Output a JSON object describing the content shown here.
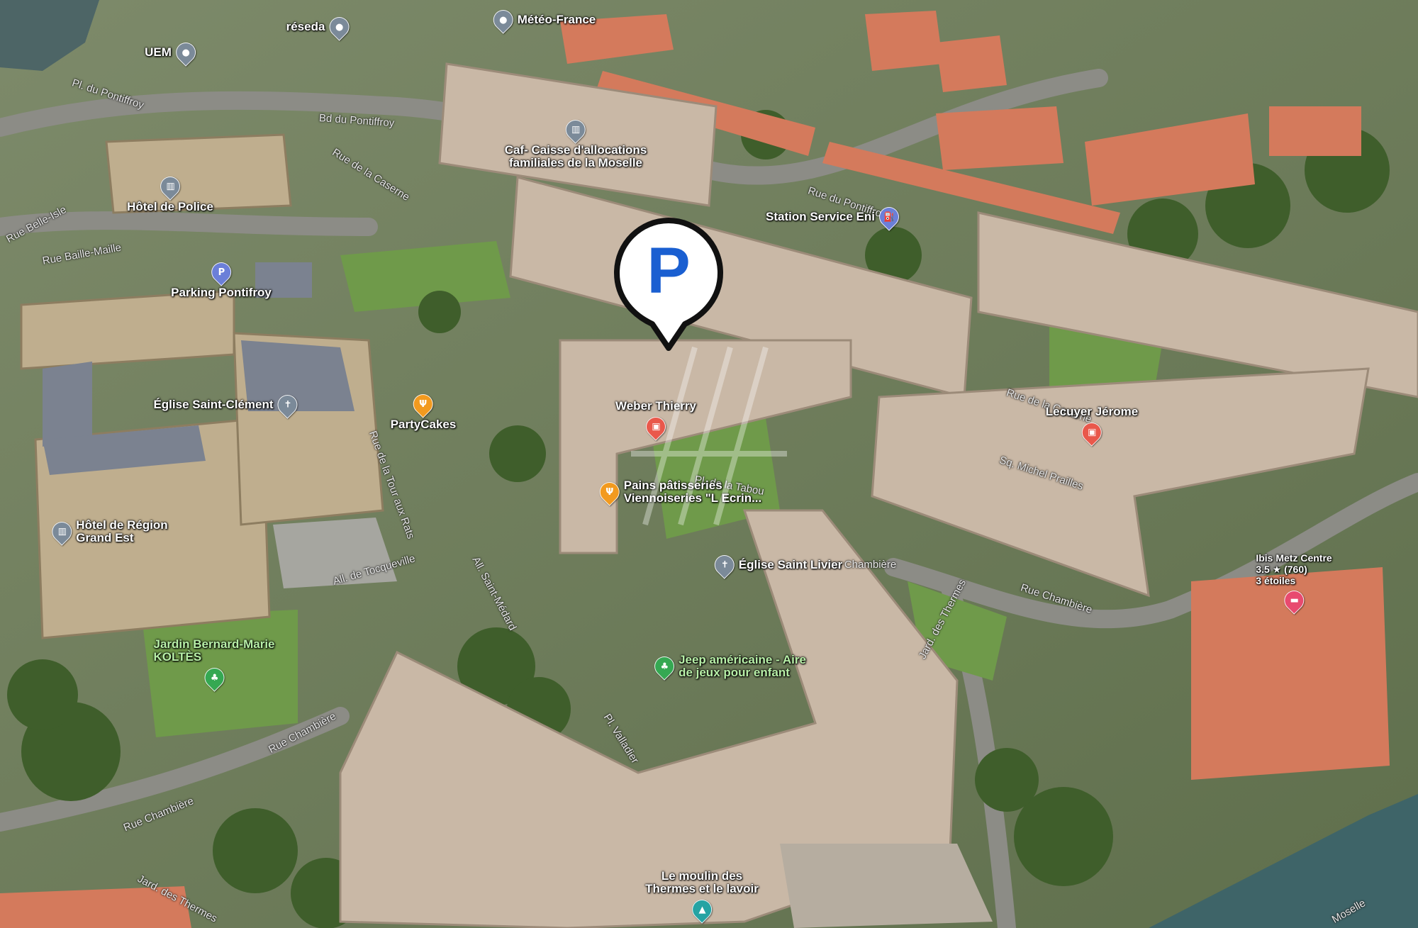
{
  "map": {
    "pois": [
      {
        "id": "meteo-france",
        "label": "Météo-France",
        "icon": "pin-icon",
        "color": "#7b8a99"
      },
      {
        "id": "reseda",
        "label": "réseda",
        "icon": "pin-icon",
        "color": "#7b8a99"
      },
      {
        "id": "uem",
        "label": "UEM",
        "icon": "pin-icon",
        "color": "#7b8a99"
      },
      {
        "id": "caf",
        "label": "Caf- Caisse d'allocations\nfamiliales de la Moselle",
        "icon": "building-icon",
        "color": "#7b8a99"
      },
      {
        "id": "hotel-police",
        "label": "Hôtel de Police",
        "icon": "building-icon",
        "color": "#7b8a99"
      },
      {
        "id": "station-eni",
        "label": "Station Service Eni",
        "icon": "fuel-icon",
        "color": "#6b7fd8"
      },
      {
        "id": "parking-pontifroy",
        "label": "Parking Pontifroy",
        "icon": "parking-icon",
        "color": "#6b7fd8"
      },
      {
        "id": "eglise-saint-clement",
        "label": "Église Saint-Clément",
        "icon": "church-icon",
        "color": "#7b8a99"
      },
      {
        "id": "partycakes",
        "label": "PartyCakes",
        "icon": "food-icon",
        "color": "#f29a1f"
      },
      {
        "id": "weber-thierry",
        "label": "Weber Thierry",
        "icon": "shop-icon",
        "color": "#e9584b"
      },
      {
        "id": "lecuyer-jerome",
        "label": "Lecuyer Jérome",
        "icon": "shop-icon",
        "color": "#e9584b"
      },
      {
        "id": "pains-patisseries",
        "label": "Pains pâtisseries\nViennoiseries \"L Ecrin...",
        "icon": "food-icon",
        "color": "#f29a1f"
      },
      {
        "id": "hotel-region",
        "label": "Hôtel de Région\nGrand Est",
        "icon": "building-icon",
        "color": "#7b8a99"
      },
      {
        "id": "eglise-saint-livier",
        "label": "Église Saint Livier",
        "icon": "church-icon",
        "color": "#7b8a99"
      },
      {
        "id": "ibis-metz",
        "label": "Ibis Metz Centre\n3.5 ★ (760)\n3 étoiles",
        "icon": "hotel-icon",
        "color": "#e84a6f"
      },
      {
        "id": "jardin-koltes",
        "label": "Jardin Bernard-Marie\nKOLTÈS",
        "icon": "park-icon",
        "color": "#35a852"
      },
      {
        "id": "jeep-americaine",
        "label": "Jeep américaine - Aire\nde jeux pour enfant",
        "icon": "park-icon",
        "color": "#35a852"
      },
      {
        "id": "moulin-thermes",
        "label": "Le moulin des\nThermes et le lavoir",
        "icon": "landmark-icon",
        "color": "#25a3a3"
      }
    ],
    "streets": [
      "Pl. du Pontiffroy",
      "Bd du Pontiffroy",
      "Rue de la Caserne",
      "Rue Belle-Isle",
      "Rue Baille-Maille",
      "Rue du Pontiffroy",
      "Rue de la Caserne",
      "Rue Chambière",
      "Rue Chambière",
      "Rue Chambière",
      "Jard. des Thermes",
      "Jard. des Thermes",
      "All. de Tocqueville",
      "All. Saint-Médard",
      "Pl. Valladier",
      "Rue de la Tour aux Rats",
      "Moselle",
      "ue Chambière",
      "Sq. Michel Prailles",
      "Pl. de la Tabou"
    ],
    "parking_marker": {
      "letter": "P",
      "icon": "parking-marker-icon",
      "color": "#1a5fd1"
    },
    "colors": {
      "river": "#3e6468",
      "roof": "#c9b8a6",
      "grass": "#6f9a4a",
      "tile_roof": "#d47a5c"
    }
  }
}
